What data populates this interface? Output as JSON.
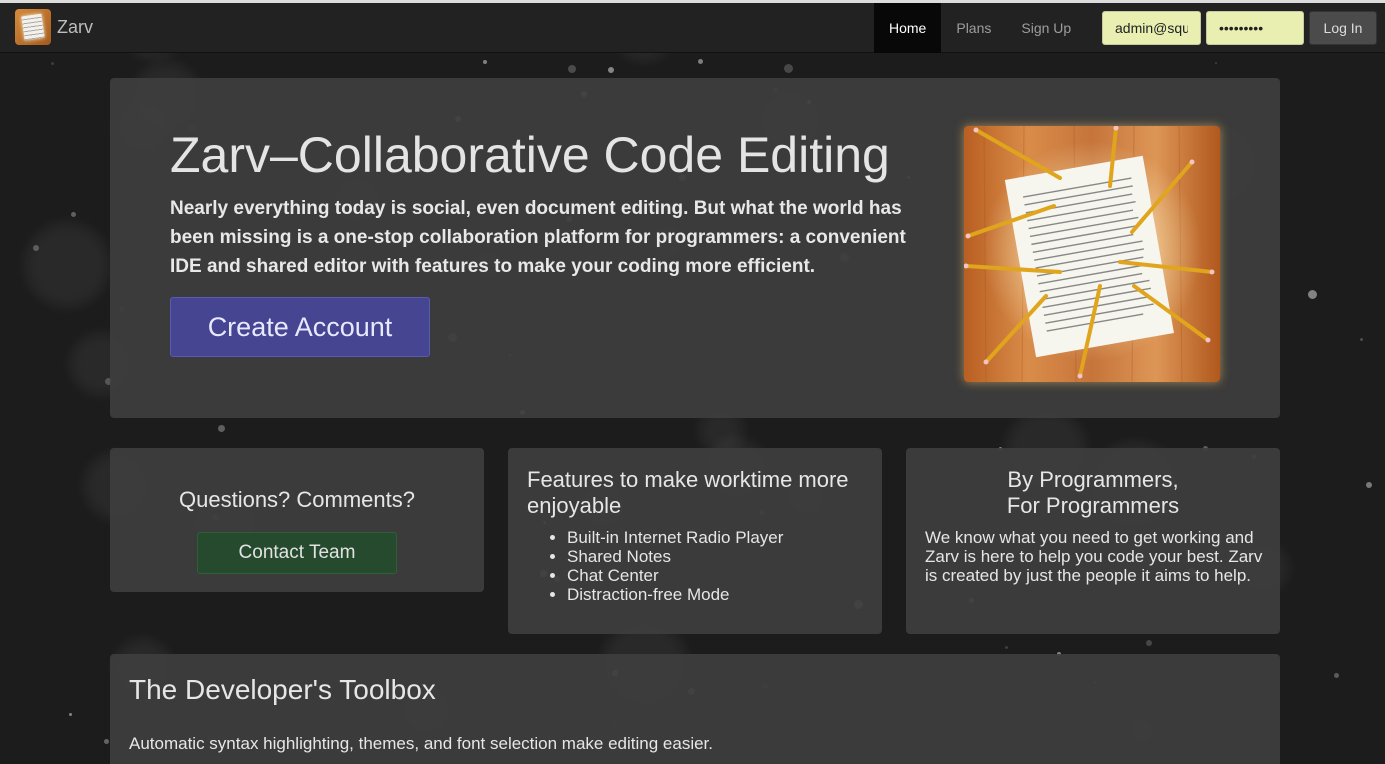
{
  "brand": {
    "name": "Zarv"
  },
  "nav": {
    "links": [
      {
        "label": "Home",
        "active": true
      },
      {
        "label": "Plans",
        "active": false
      },
      {
        "label": "Sign Up",
        "active": false
      }
    ]
  },
  "login": {
    "email_value": "admin@squ",
    "password_value": "•••••••••",
    "button_label": "Log In"
  },
  "hero": {
    "title": "Zarv–Collaborative Code Editing",
    "text": "Nearly everything today is social, even document editing. But what the world has been missing is a one-stop collaboration platform for programmers: a convenient IDE and shared editor with features to make your coding more efficient.",
    "button_label": "Create Account"
  },
  "questions": {
    "title": "Questions? Comments?",
    "button_label": "Contact Team"
  },
  "features": {
    "title": "Features to make worktime more enjoyable",
    "items": [
      "Built-in Internet Radio Player",
      "Shared Notes",
      "Chat Center",
      "Distraction-free Mode"
    ]
  },
  "programmers": {
    "title_line1": "By Programmers,",
    "title_line2": "For Programmers",
    "text": "We know what you need to get working and Zarv is here to help you code your best. Zarv is created by just the people it aims to help."
  },
  "toolbox": {
    "title": "The Developer's Toolbox",
    "text": "Automatic syntax highlighting, themes, and font selection make editing easier."
  },
  "colors": {
    "background": "#1c1c1c",
    "panel": "#3e3e3e",
    "primary_button": "#454592",
    "success_button": "#264a2e",
    "input_autofill": "#e8efb0"
  }
}
